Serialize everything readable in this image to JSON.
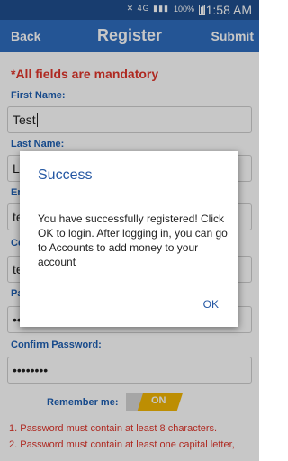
{
  "status_bar": {
    "network": "4G",
    "battery": "100%",
    "time": "11:58 AM"
  },
  "app_bar": {
    "back_label": "Back",
    "title": "Register",
    "submit_label": "Submit"
  },
  "form": {
    "mandatory_note": "*All fields are mandatory",
    "first_name_label": "First Name:",
    "first_name_value": "Test",
    "last_name_label": "Last Name:",
    "last_name_value": "L",
    "email_label": "En",
    "email_value": "te",
    "confirm_email_label": "Co",
    "confirm_email_value": "te",
    "password_label": "Pa",
    "password_value": "••",
    "confirm_password_label": "Confirm Password:",
    "confirm_password_value": "••••••••",
    "remember_label": "Remember me:",
    "remember_toggle": "ON"
  },
  "rules": [
    "1. Password must contain at least 8 characters.",
    "2. Password must contain at least one capital letter,"
  ],
  "dialog": {
    "title": "Success",
    "message": "You have successfully registered! Click OK to login. After logging in, you can go to Accounts to add money to your account",
    "ok_label": "OK"
  },
  "colors": {
    "app_bar": "#2f6dbf",
    "status_bar": "#1f4f8f",
    "label_blue": "#1e5fb3",
    "error_red": "#e0352b",
    "toggle_on": "#f2b705"
  }
}
